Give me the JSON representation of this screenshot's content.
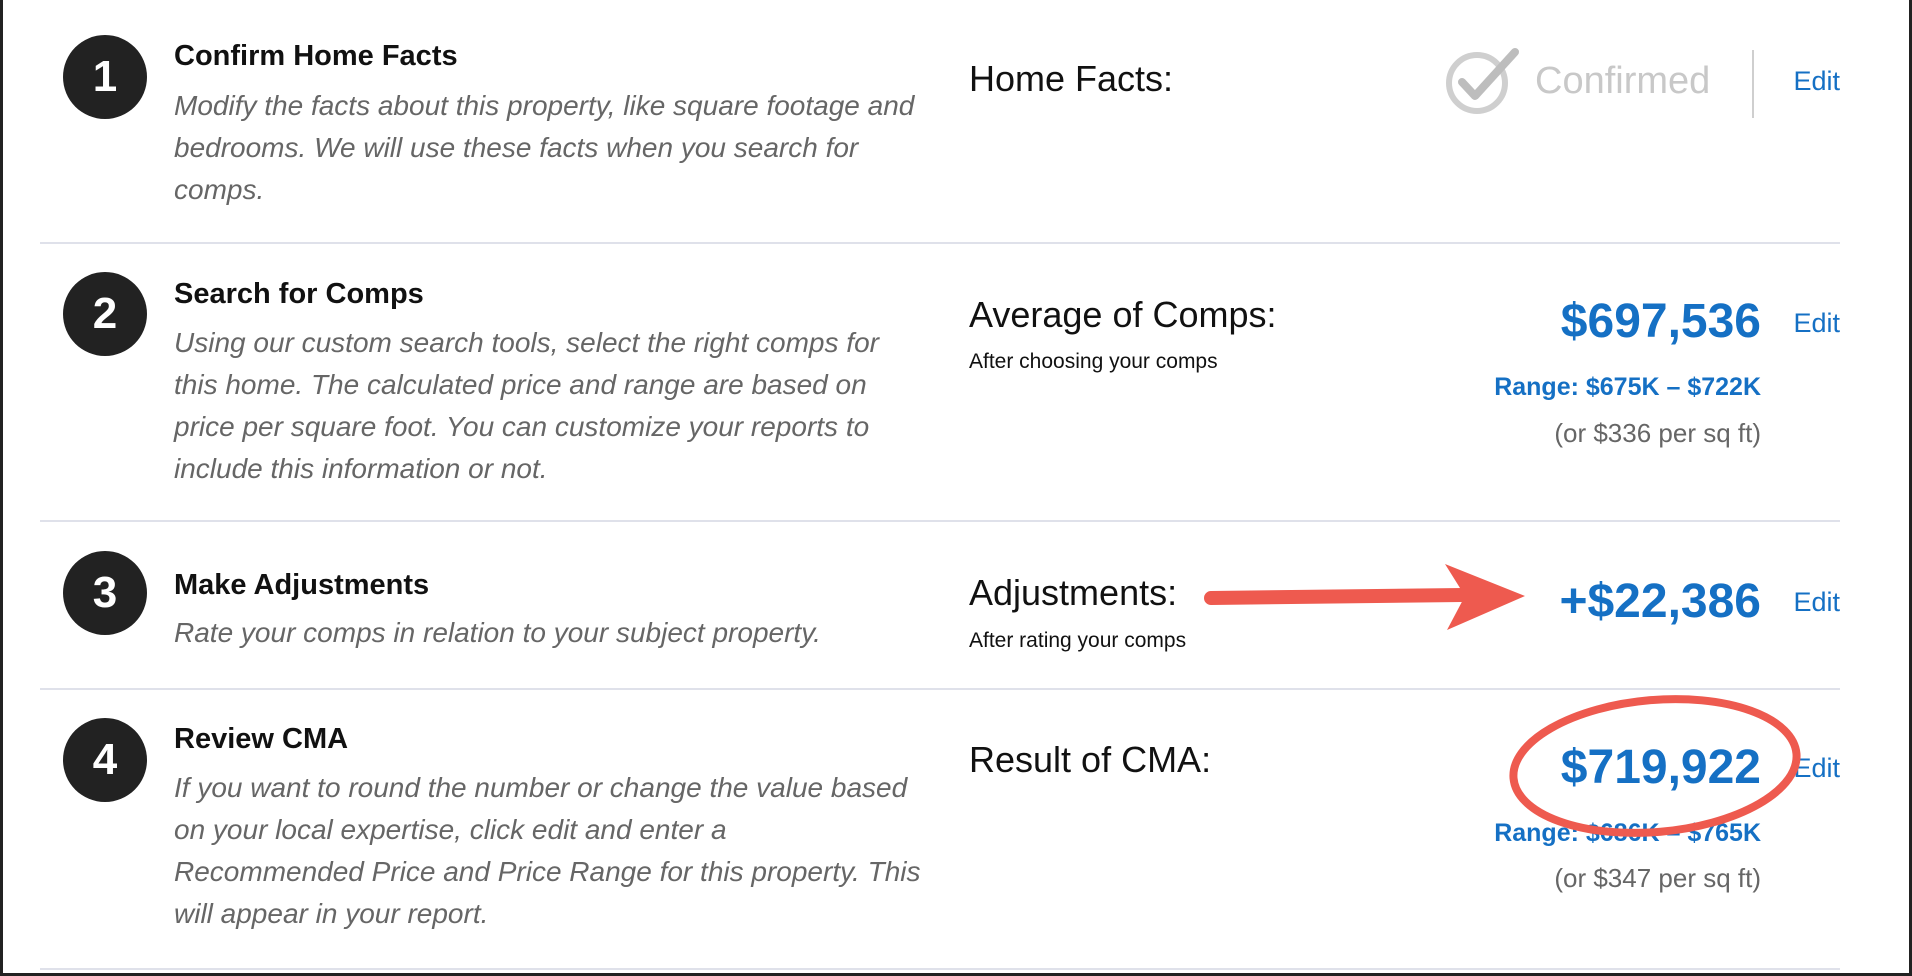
{
  "steps": [
    {
      "number": "1",
      "title": "Confirm Home Facts",
      "description": "Modify the facts about this property, like square footage and bedrooms. We will use these facts when you search for comps.",
      "metric_label": "Home Facts:",
      "status": "Confirmed",
      "edit_label": "Edit"
    },
    {
      "number": "2",
      "title": "Search for Comps",
      "description": "Using our custom search tools, select the right comps for this home. The calculated price and range are based on price per square foot. You can customize your reports to include this information or not.",
      "metric_label": "Average of Comps:",
      "metric_sub": "After choosing your comps",
      "value": "$697,536",
      "range": "Range: $675K – $722K",
      "per_sqft": "(or $336 per sq ft)",
      "edit_label": "Edit"
    },
    {
      "number": "3",
      "title": "Make Adjustments",
      "description": "Rate your comps in relation to your subject property.",
      "metric_label": "Adjustments:",
      "metric_sub": "After rating your comps",
      "value": "+$22,386",
      "edit_label": "Edit"
    },
    {
      "number": "4",
      "title": "Review CMA",
      "description": "If you want to round the number or change the value based on your local expertise, click edit and enter a Recommended Price and Price Range for this property. This will appear in your report.",
      "metric_label": "Result of CMA:",
      "value": "$719,922",
      "range": "Range: $686K – $765K",
      "per_sqft": "(or $347 per sq ft)",
      "edit_label": "Edit"
    }
  ],
  "icons": {
    "confirmed": "check-circle-icon",
    "annotation_arrow": "arrow-right-icon",
    "annotation_ellipse": "highlight-ellipse"
  },
  "colors": {
    "accent_blue": "#1570c4",
    "step_circle": "#222222",
    "annotation_red": "#ee5a4f",
    "confirmed_gray": "#c8c8c8",
    "divider": "#dfe1ea"
  }
}
